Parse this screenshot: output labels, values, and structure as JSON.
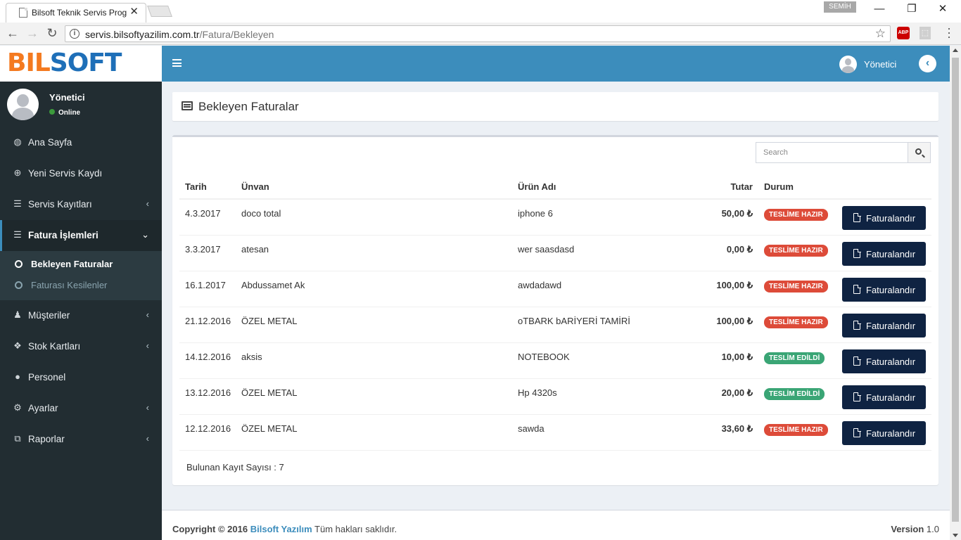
{
  "browser": {
    "tab_title": "Bilsoft Teknik Servis Prog",
    "profile_name": "SEMİH",
    "url_host": "servis.bilsoftyazilim.com.tr",
    "url_path": "/Fatura/Bekleyen",
    "extension_abp": "ABP"
  },
  "brand": {
    "part1": "BIL",
    "part2": "SOFT"
  },
  "user": {
    "name": "Yönetici",
    "status": "Online"
  },
  "sidebar": {
    "items": [
      {
        "label": "Ana Sayfa",
        "icon": "dashboard-icon",
        "glyph": "◍"
      },
      {
        "label": "Yeni Servis Kaydı",
        "icon": "plus-circle-icon",
        "glyph": "⊕"
      },
      {
        "label": "Servis Kayıtları",
        "icon": "list-icon",
        "glyph": "☰"
      },
      {
        "label": "Fatura İşlemleri",
        "icon": "list-icon",
        "glyph": "☰"
      },
      {
        "label": "Müşteriler",
        "icon": "users-icon",
        "glyph": "👥"
      },
      {
        "label": "Stok Kartları",
        "icon": "cubes-icon",
        "glyph": "❖"
      },
      {
        "label": "Personel",
        "icon": "user-icon",
        "glyph": "●"
      },
      {
        "label": "Ayarlar",
        "icon": "cogs-icon",
        "glyph": "⚙"
      },
      {
        "label": "Raporlar",
        "icon": "copy-icon",
        "glyph": "⧉"
      }
    ],
    "submenu": [
      {
        "label": "Bekleyen Faturalar"
      },
      {
        "label": "Faturası Kesilenler"
      }
    ]
  },
  "navbar": {
    "user": "Yönetici"
  },
  "page": {
    "title": "Bekleyen Faturalar"
  },
  "search": {
    "placeholder": "Search"
  },
  "table": {
    "headers": {
      "date": "Tarih",
      "name": "Ünvan",
      "product": "Ürün Adı",
      "amount": "Tutar",
      "status": "Durum"
    },
    "action_label": "Faturalandır",
    "rows": [
      {
        "date": "4.3.2017",
        "name": "doco total",
        "product": "iphone 6",
        "amount": "50,00 ₺",
        "status": "TESLİME HAZIR",
        "status_color": "#dd4b39"
      },
      {
        "date": "3.3.2017",
        "name": "atesan",
        "product": "wer saasdasd",
        "amount": "0,00 ₺",
        "status": "TESLİME HAZIR",
        "status_color": "#dd4b39"
      },
      {
        "date": "16.1.2017",
        "name": "Abdussamet Ak",
        "product": "awdadawd",
        "amount": "100,00 ₺",
        "status": "TESLİME HAZIR",
        "status_color": "#dd4b39"
      },
      {
        "date": "21.12.2016",
        "name": "ÖZEL METAL",
        "product": "oTBARK bARİYERİ TAMİRİ",
        "amount": "100,00 ₺",
        "status": "TESLİME HAZIR",
        "status_color": "#dd4b39"
      },
      {
        "date": "14.12.2016",
        "name": "aksis",
        "product": "NOTEBOOK",
        "amount": "10,00 ₺",
        "status": "TESLİM EDİLDİ",
        "status_color": "#3aa575"
      },
      {
        "date": "13.12.2016",
        "name": "ÖZEL METAL",
        "product": "Hp 4320s",
        "amount": "20,00 ₺",
        "status": "TESLİM EDİLDİ",
        "status_color": "#3aa575"
      },
      {
        "date": "12.12.2016",
        "name": "ÖZEL METAL",
        "product": "sawda",
        "amount": "33,60 ₺",
        "status": "TESLİME HAZIR",
        "status_color": "#dd4b39"
      }
    ]
  },
  "record_count": "Bulunan Kayıt Sayısı : 7",
  "footer": {
    "copyright": "Copyright © 2016",
    "brand": "Bilsoft Yazılım",
    "rights": "Tüm hakları saklıdır.",
    "version_label": "Version",
    "version": "1.0"
  },
  "colors": {
    "accent": "#3c8dbc",
    "sidebar_bg": "#222d32",
    "button_bg": "#0f2342",
    "danger": "#dd4b39",
    "success": "#3aa575"
  }
}
